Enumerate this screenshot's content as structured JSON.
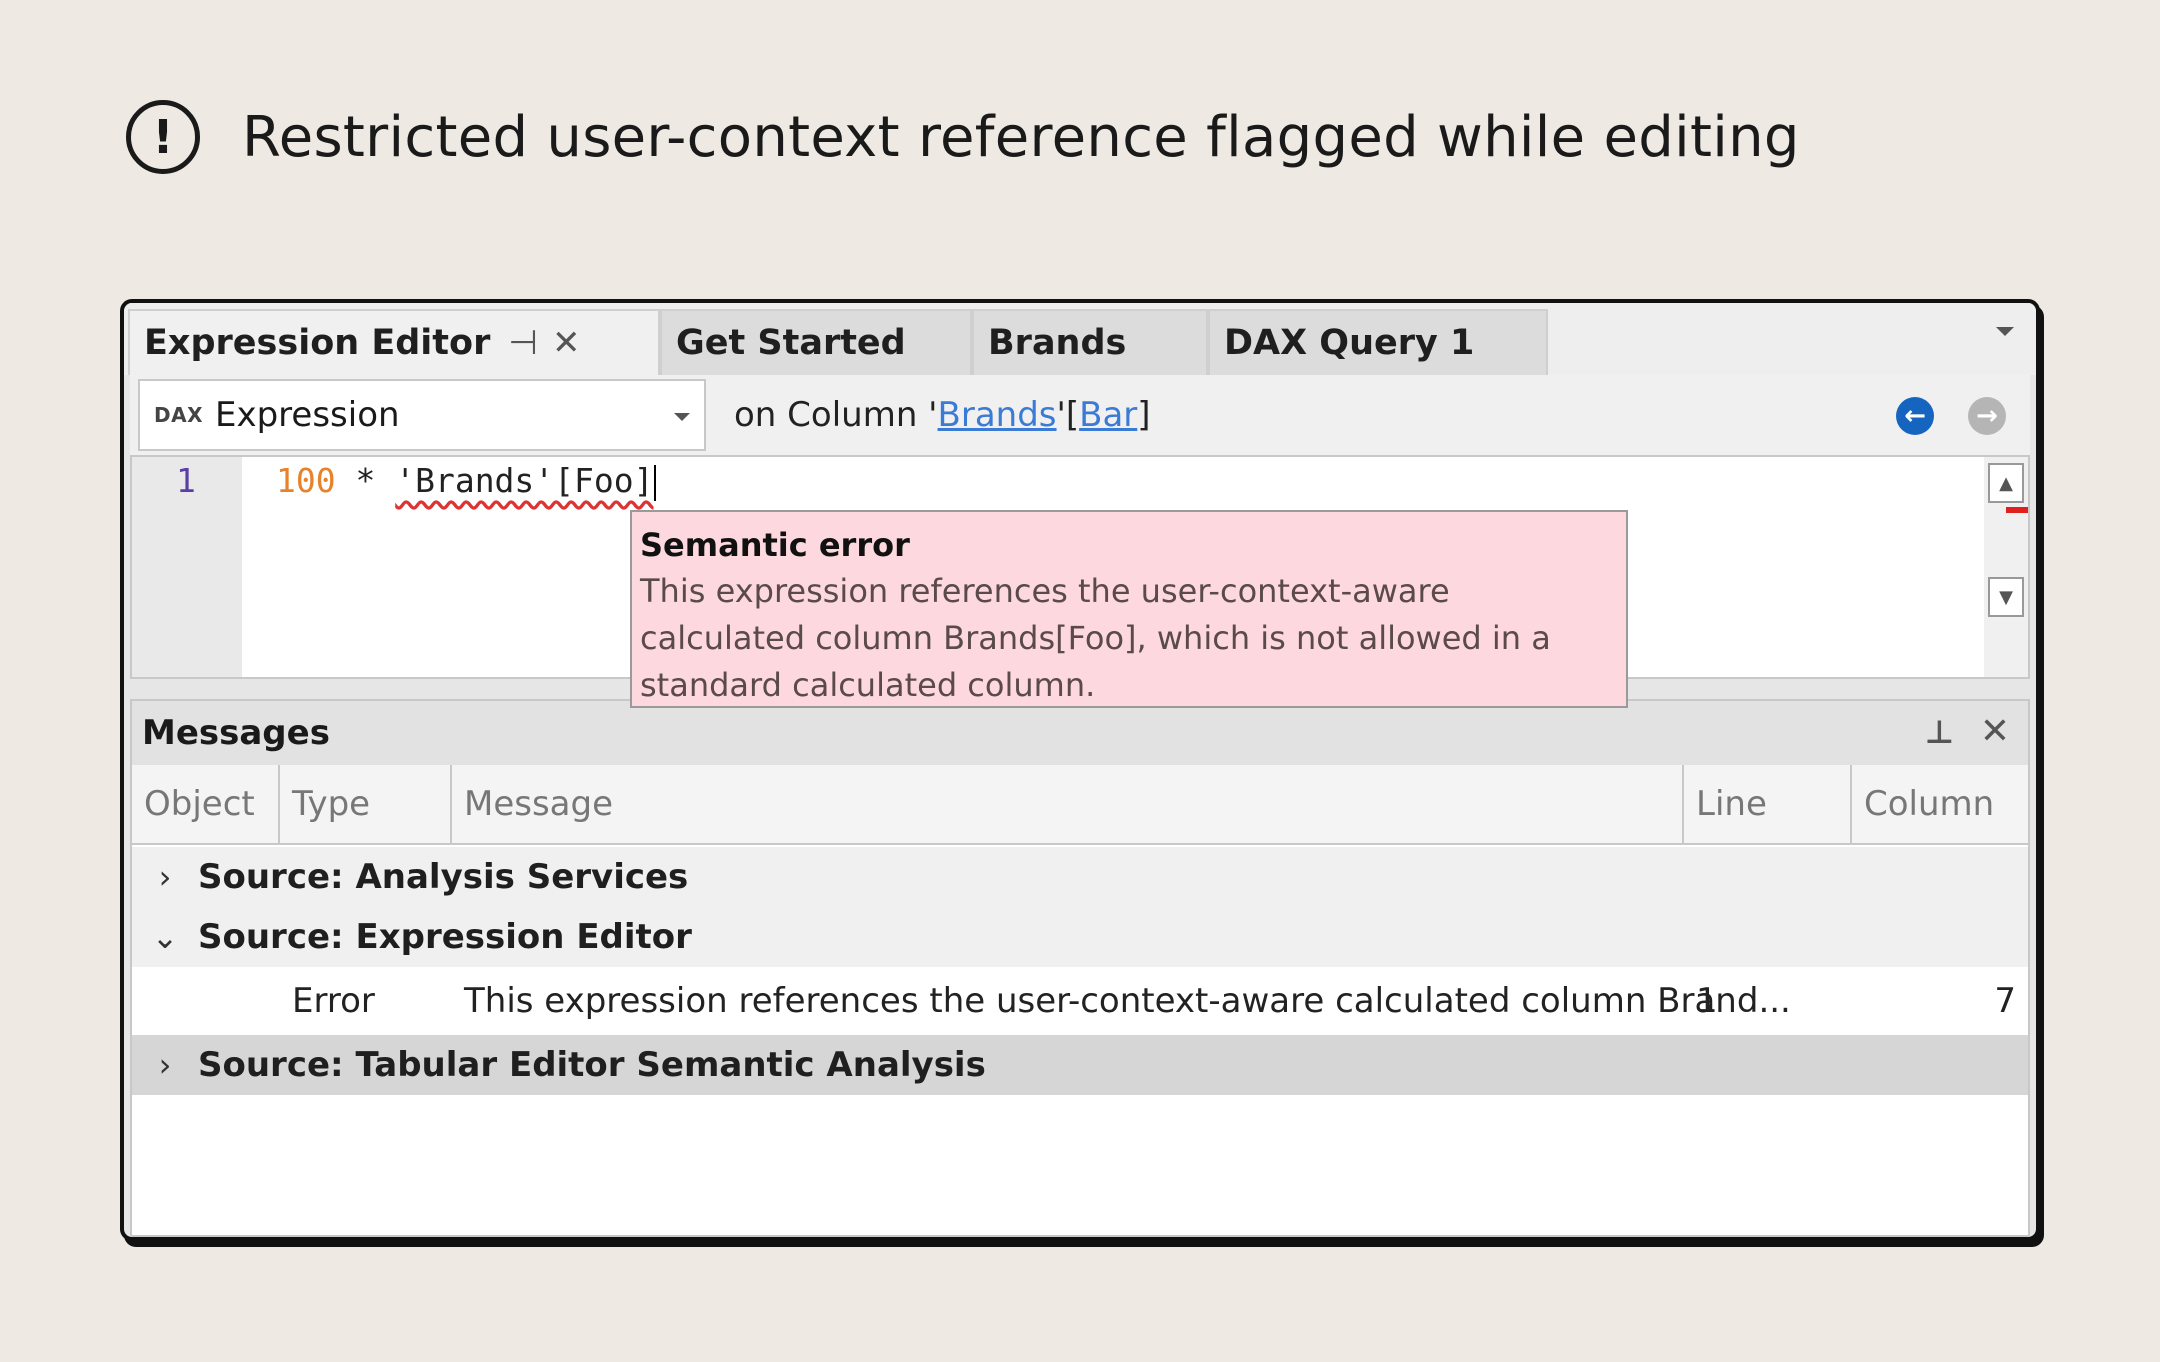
{
  "page": {
    "title": "Restricted user-context reference flagged while editing",
    "icon": "alert-circle-icon"
  },
  "tabs": [
    {
      "label": "Expression Editor",
      "active": true,
      "pin_icon": "⊣",
      "close_icon": "✕"
    },
    {
      "label": "Get Started"
    },
    {
      "label": "Brands"
    },
    {
      "label": "DAX Query 1"
    }
  ],
  "toolbar": {
    "badge": "DAX",
    "selected_property": "Expression",
    "context_prefix": "on Column '",
    "context_table": "Brands",
    "context_mid": "'[",
    "context_column": "Bar",
    "context_suffix": "]"
  },
  "editor": {
    "line_number": "1",
    "code": {
      "number": "100",
      "operator": " * ",
      "reference": "'Brands'[Foo]"
    }
  },
  "tooltip": {
    "title": "Semantic error",
    "body": "This expression references the user-context-aware calculated column Brands[Foo], which is not allowed in a standard calculated column."
  },
  "messages": {
    "title": "Messages",
    "columns": [
      "Object",
      "Type",
      "Message",
      "Line",
      "Column"
    ],
    "groups": [
      {
        "label": "Source: Analysis Services",
        "expanded": false
      },
      {
        "label": "Source: Expression Editor",
        "expanded": true
      },
      {
        "label": "Source: Tabular Editor Semantic Analysis",
        "expanded": false
      }
    ],
    "row": {
      "type": "Error",
      "message": "This expression references the user-context-aware calculated column Brand...",
      "line": "1",
      "column": "7"
    }
  }
}
